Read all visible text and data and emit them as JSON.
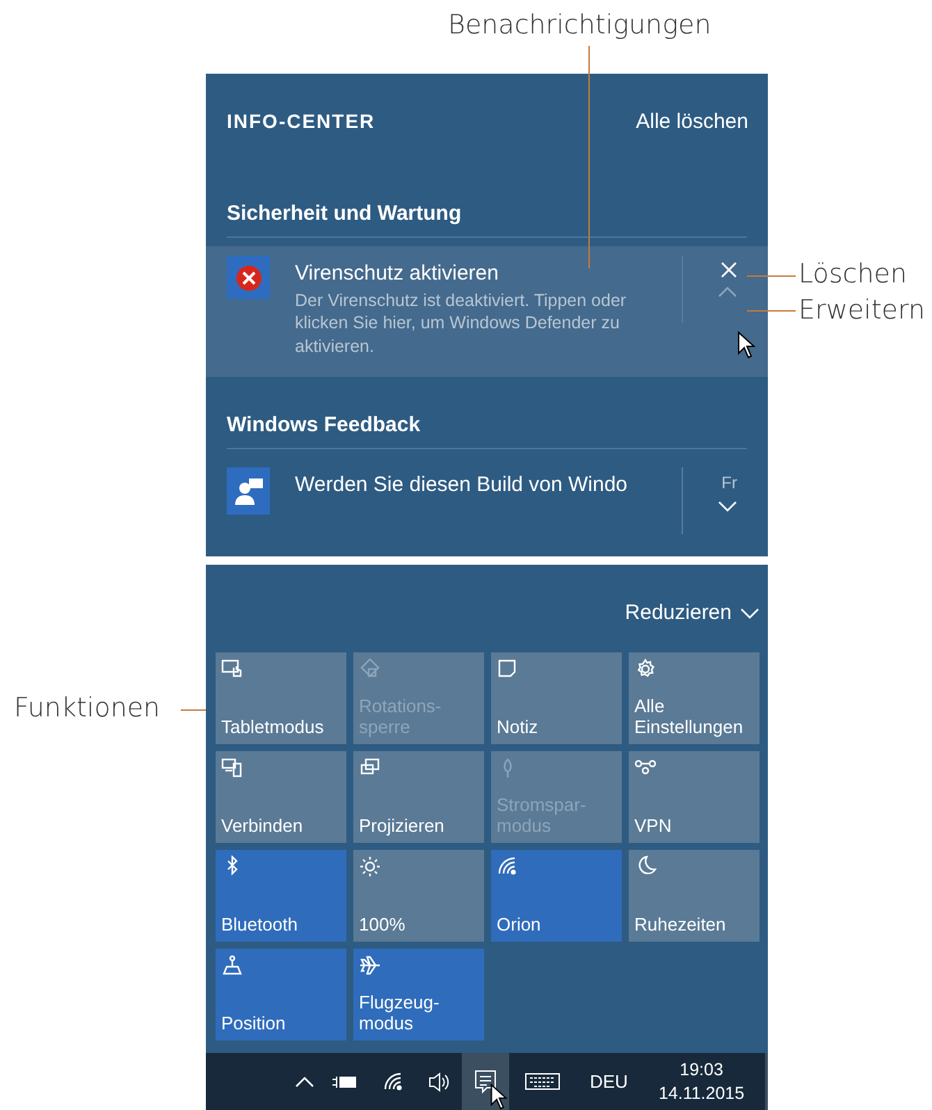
{
  "callouts": [
    {
      "label": "Benachrichtigungen"
    },
    {
      "label": "Löschen"
    },
    {
      "label": "Erweitern"
    },
    {
      "label": "Funktionen"
    }
  ],
  "info_center": {
    "title": "INFO-CENTER",
    "clear_all": "Alle löschen",
    "groups": [
      {
        "title": "Sicherheit und Wartung",
        "items": [
          {
            "title": "Virenschutz aktivieren",
            "body": "Der Virenschutz ist deaktiviert. Tippen oder klicken Sie hier, um Windows Defender zu aktivieren.",
            "hovered": true,
            "expanded": true
          }
        ]
      },
      {
        "title": "Windows Feedback",
        "items": [
          {
            "title": "Werden Sie diesen Build von Windo",
            "time": "Fr",
            "hovered": false,
            "expanded": false
          }
        ]
      }
    ]
  },
  "quick_actions": {
    "collapse": "Reduzieren",
    "tiles": [
      {
        "label": "Tabletmodus",
        "on": false,
        "disabled": false
      },
      {
        "label": "Rotations-\nsperre",
        "on": false,
        "disabled": true
      },
      {
        "label": "Notiz",
        "on": false,
        "disabled": false
      },
      {
        "label": "Alle\nEinstellungen",
        "on": false,
        "disabled": false
      },
      {
        "label": "Verbinden",
        "on": false,
        "disabled": false
      },
      {
        "label": "Projizieren",
        "on": false,
        "disabled": false
      },
      {
        "label": "Stromspar-\nmodus",
        "on": false,
        "disabled": true
      },
      {
        "label": "VPN",
        "on": false,
        "disabled": false
      },
      {
        "label": "Bluetooth",
        "on": true,
        "disabled": false
      },
      {
        "label": "100%",
        "on": false,
        "disabled": false
      },
      {
        "label": "Orion",
        "on": true,
        "disabled": false
      },
      {
        "label": "Ruhezeiten",
        "on": false,
        "disabled": false
      },
      {
        "label": "Position",
        "on": true,
        "disabled": false
      },
      {
        "label": "Flugzeug-\nmodus",
        "on": true,
        "disabled": false
      }
    ]
  },
  "taskbar": {
    "language": "DEU",
    "time": "19:03",
    "date": "14.11.2015",
    "action_center_selected": true
  }
}
